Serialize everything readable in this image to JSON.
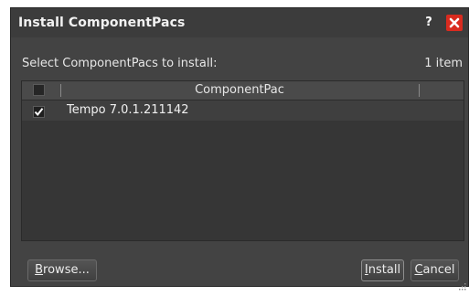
{
  "dialog": {
    "title": "Install ComponentPacs",
    "help_label": "?"
  },
  "prompt": "Select ComponentPacs to install:",
  "item_count": "1 item",
  "table": {
    "column_header": "ComponentPac",
    "rows": [
      {
        "checked": true,
        "label": "Tempo 7.0.1.211142"
      }
    ]
  },
  "buttons": {
    "browse_mnemonic": "B",
    "browse_rest": "rowse...",
    "install_mnemonic": "I",
    "install_rest": "nstall",
    "cancel_mnemonic": "C",
    "cancel_rest": "ancel"
  },
  "icons": {
    "help": "help-icon",
    "close": "close-icon",
    "checkbox": "checkbox-icon",
    "resize": "resize-grip-icon"
  },
  "colors": {
    "dialog_background": "#434343",
    "close_button": "#d92b1f",
    "text": "#e6e6e6"
  }
}
